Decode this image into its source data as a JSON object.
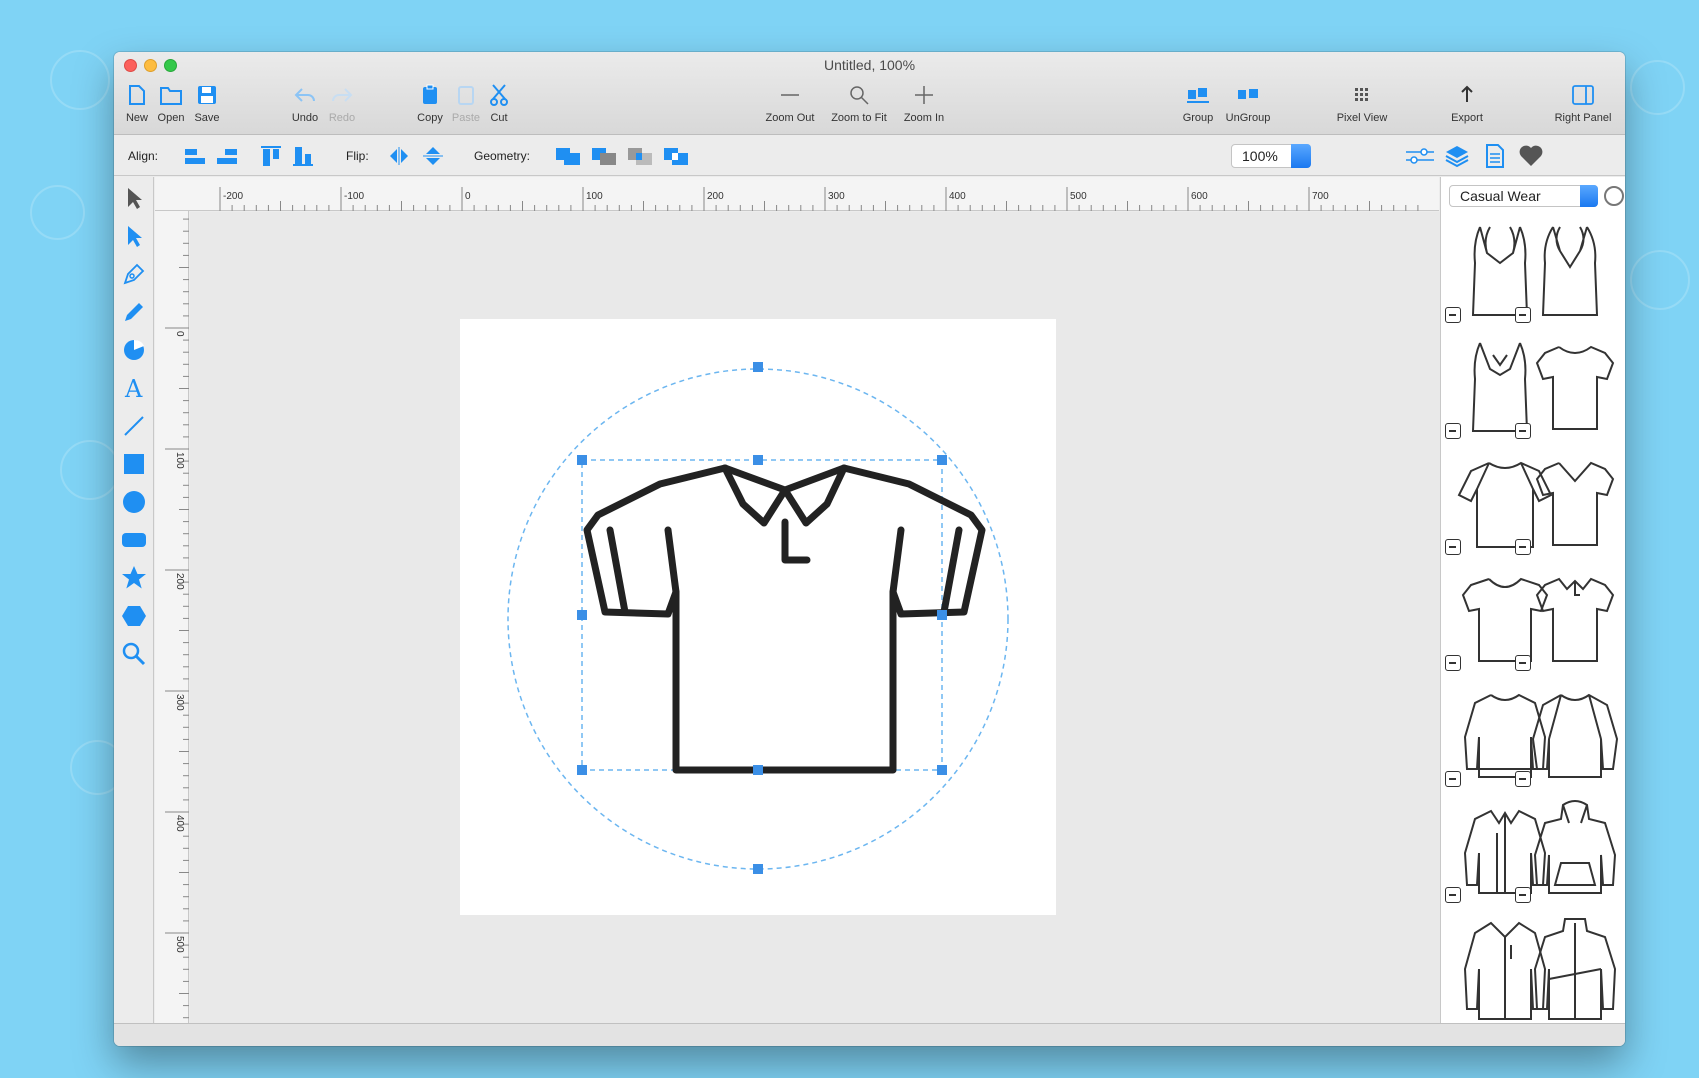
{
  "window": {
    "title": "Untitled, 100%"
  },
  "toolbar": {
    "new_label": "New",
    "open_label": "Open",
    "save_label": "Save",
    "undo_label": "Undo",
    "redo_label": "Redo",
    "copy_label": "Copy",
    "paste_label": "Paste",
    "cut_label": "Cut",
    "zoom_out_label": "Zoom Out",
    "zoom_fit_label": "Zoom to Fit",
    "zoom_in_label": "Zoom In",
    "group_label": "Group",
    "ungroup_label": "UnGroup",
    "pixel_view_label": "Pixel View",
    "export_label": "Export",
    "right_panel_label": "Right Panel"
  },
  "secondary_toolbar": {
    "align_label": "Align:",
    "flip_label": "Flip:",
    "geometry_label": "Geometry:",
    "zoom_value": "100%"
  },
  "ruler": {
    "top_ticks": [
      "-200",
      "-100",
      "0",
      "100",
      "200",
      "300",
      "400",
      "500",
      "600",
      "700"
    ],
    "left_ticks": [
      "0",
      "100",
      "200",
      "300",
      "400",
      "500"
    ]
  },
  "right_panel": {
    "category": "Casual Wear"
  },
  "colors": {
    "accent": "#1f8ff2",
    "selection": "#3b8fe6",
    "background": "#7fd3f5"
  },
  "icons": [
    "new-document-icon",
    "open-folder-icon",
    "save-disk-icon",
    "undo-icon",
    "redo-icon",
    "copy-icon",
    "paste-icon",
    "cut-scissors-icon",
    "zoom-out-icon",
    "zoom-fit-magnifier-icon",
    "zoom-in-icon",
    "group-icon",
    "ungroup-icon",
    "pixel-grid-icon",
    "export-icon",
    "right-panel-icon",
    "arrow-select-icon",
    "direct-select-icon",
    "pen-icon",
    "pencil-icon",
    "shape-builder-icon",
    "text-icon",
    "line-icon",
    "rectangle-icon",
    "circle-icon",
    "rounded-rect-icon",
    "star-icon",
    "hexagon-icon",
    "magnifier-icon",
    "sliders-icon",
    "layers-icon",
    "document-icon",
    "heart-icon",
    "gear-icon"
  ]
}
